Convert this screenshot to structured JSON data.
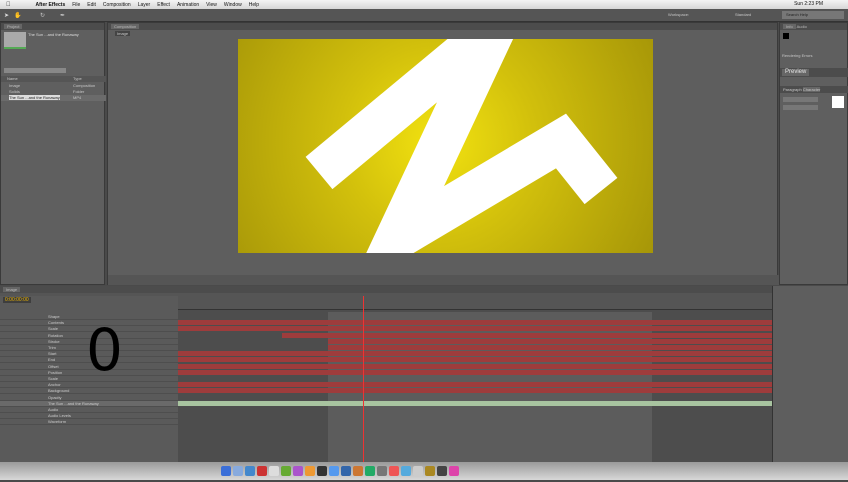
{
  "menubar": {
    "app": "After Effects",
    "items": [
      "File",
      "Edit",
      "Composition",
      "Layer",
      "Effect",
      "Animation",
      "View",
      "Window",
      "Help"
    ],
    "clock": "Sun 2:23 PM"
  },
  "workspace": {
    "label": "Workspace:",
    "value": "Standard",
    "search": "Search Help"
  },
  "project": {
    "tab": "Project",
    "item_name": "The Sun ...and the Runaway",
    "search": "",
    "column_name": "Name",
    "column_type": "Type",
    "items": [
      {
        "name": "Image",
        "type": "Composition"
      },
      {
        "name": "Solids",
        "type": "Folder"
      },
      {
        "name": "The Sun ...and the Runaway",
        "type": "MP4"
      }
    ]
  },
  "viewer": {
    "tab": "Composition",
    "breadcrumb": "Image"
  },
  "right": {
    "info_tab": "Info",
    "audio_tab": "Audio",
    "rendering": "Rendering Errors",
    "preview_tab": "Preview",
    "character_tab": "Character",
    "paragraph_tab": "Paragraph"
  },
  "timeline": {
    "tab": "Image",
    "timecode": "0:00:00:00",
    "big_overlay": "0",
    "layers": [
      "Shape",
      "Contents",
      "Scale",
      "Rotation",
      "Stroke",
      "Trim",
      "Start",
      "End",
      "Offset",
      "Position",
      "Scale",
      "Anchor",
      "Background",
      "Opacity",
      "The Sun ...and the Runaway",
      "Audio",
      "Audio Levels",
      "Waveform"
    ]
  },
  "colors": {
    "comp_bg": "#d8c70d",
    "bar_red": "#9e3c3c",
    "bar_green": "#a8c4a0",
    "playhead": "#ee3333"
  }
}
